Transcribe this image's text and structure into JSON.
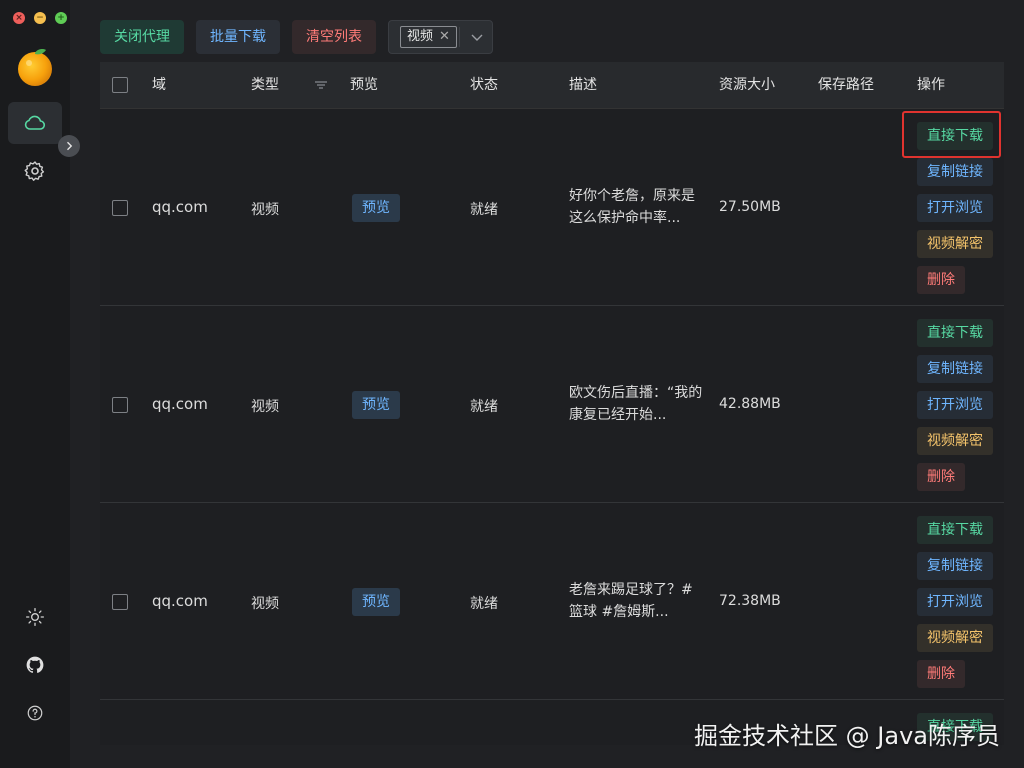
{
  "toolbar": {
    "close_proxy": "关闭代理",
    "batch_download": "批量下载",
    "clear_list": "清空列表",
    "filter_chip": "视频"
  },
  "table": {
    "headers": {
      "domain": "域",
      "type": "类型",
      "preview": "预览",
      "status": "状态",
      "description": "描述",
      "size": "资源大小",
      "save_path": "保存路径",
      "actions": "操作"
    },
    "rows": [
      {
        "domain": "qq.com",
        "type": "视频",
        "preview": "预览",
        "status": "就绪",
        "description": "好你个老詹，原来是这么保护命中率...",
        "size": "27.50MB"
      },
      {
        "domain": "qq.com",
        "type": "视频",
        "preview": "预览",
        "status": "就绪",
        "description": "欧文伤后直播：“我的康复已经开始...",
        "size": "42.88MB"
      },
      {
        "domain": "qq.com",
        "type": "视频",
        "preview": "预览",
        "status": "就绪",
        "description": "老詹来踢足球了？#篮球 #詹姆斯...",
        "size": "72.38MB"
      }
    ],
    "action_labels": {
      "direct_download": "直接下载",
      "copy_link": "复制链接",
      "open_browse": "打开浏览",
      "video_decrypt": "视频解密",
      "delete": "删除"
    },
    "partial_row_action": "直接下载"
  },
  "watermark": "掘金技术社区 @ Java陈序员",
  "icons": {
    "sidebar_logo": "orange-icon",
    "sidebar_active": "cloud-icon",
    "sidebar_settings": "gear-icon",
    "theme": "sun-icon",
    "github": "github-icon",
    "help": "help-icon"
  },
  "colors": {
    "accent_green": "#57d9a3",
    "accent_blue": "#6fb6ff",
    "accent_red": "#ff7b78",
    "accent_yellow": "#f5c46b",
    "highlight_box": "#e0332f"
  }
}
